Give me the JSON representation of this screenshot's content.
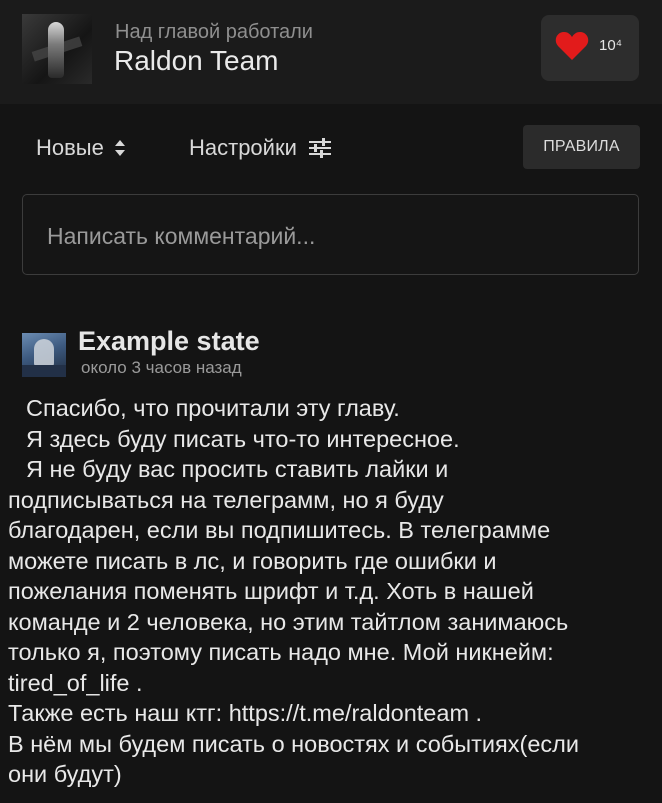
{
  "header": {
    "subtitle": "Над главой работали",
    "team_name": "Raldon Team",
    "likes": "10⁴",
    "like_color": "#e21b1b"
  },
  "toolbar": {
    "sort_label": "Новые",
    "sort_icon": "sort-updown-icon",
    "settings_label": "Настройки",
    "settings_icon": "sliders-icon",
    "rules_label": "ПРАВИЛА"
  },
  "comment_box": {
    "placeholder": "Написать комментарий..."
  },
  "comment": {
    "author": "Example state",
    "time": "около 3 часов назад",
    "lines": [
      "Спасибо, что прочитали эту главу.",
      "Я здесь буду писать что-то интересное.",
      "Я не буду вас просить ставить лайки и",
      "подписываться на телеграмм, но я буду",
      "благодарен, если вы подпишитесь. В телеграмме",
      "можете писать в лс, и говорить где ошибки и",
      "пожелания поменять шрифт и т.д. Хоть в нашей",
      "команде и 2 человека, но этим тайтлом занимаюсь",
      "только я, поэтому писать надо мне. Мой никнейм:",
      "tired_of_life .",
      "Также есть наш ктг: https://t.me/raldonteam .",
      "В нём мы будем писать о новостях и событиях(если",
      "они будут)"
    ]
  }
}
